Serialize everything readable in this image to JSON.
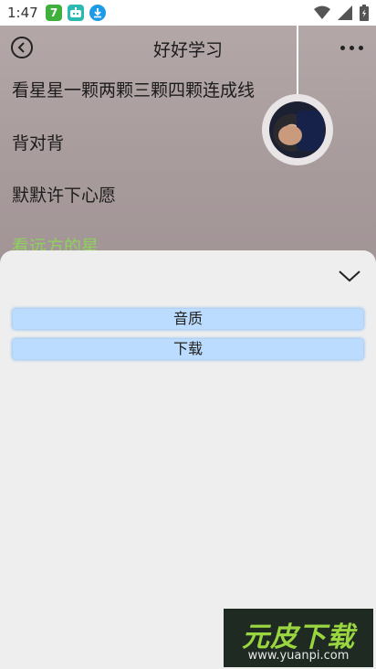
{
  "status_bar": {
    "time": "1:47",
    "app_icons": [
      "7",
      "robot-icon",
      "download-icon"
    ]
  },
  "header": {
    "title": "好好学习"
  },
  "lyrics": [
    {
      "text": "看星星一颗两颗三颗四颗连成线",
      "active": false
    },
    {
      "text": "背对背",
      "active": false
    },
    {
      "text": "默默许下心愿",
      "active": false
    },
    {
      "text": "看远方的星",
      "active": true
    }
  ],
  "sheet": {
    "options": [
      "音质",
      "下载"
    ]
  },
  "watermark": {
    "title": "元皮下载",
    "url": "www.yuanpi.com"
  },
  "colors": {
    "active_lyric": "#8ed15a",
    "option_bg": "#bcdcff",
    "sheet_bg": "#eeeeee"
  }
}
